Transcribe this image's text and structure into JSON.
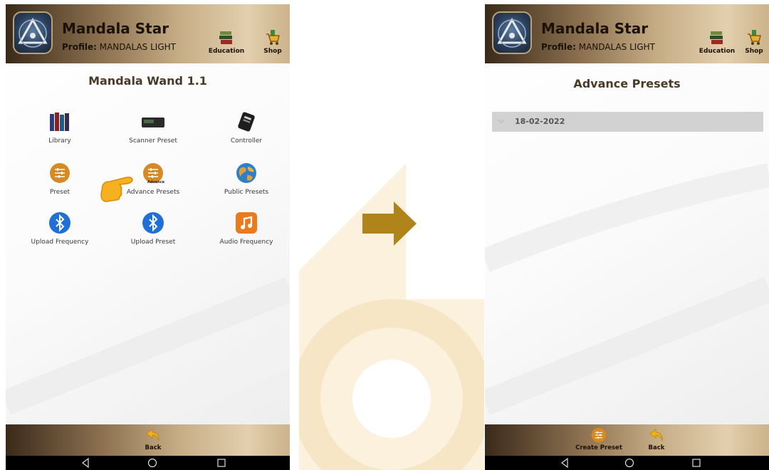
{
  "colors": {
    "header_gold": "#c4ab84",
    "header_dark": "#3a2a1a",
    "arrow": "#b0841a",
    "icon_orange": "#d78a23",
    "row_grey": "#d2d2d2"
  },
  "left_screen": {
    "header": {
      "app_title": "Mandala Star",
      "profile_label": "Profile:",
      "profile_name": "MANDALAS LIGHT",
      "education_label": "Education",
      "shop_label": "Shop"
    },
    "page_title": "Mandala Wand 1.1",
    "grid": [
      {
        "label": "Library",
        "icon": "books-icon"
      },
      {
        "label": "Scanner Preset",
        "icon": "scanner-device-icon"
      },
      {
        "label": "Controller",
        "icon": "controller-device-icon"
      },
      {
        "label": "Preset",
        "icon": "sliders-icon"
      },
      {
        "label": "Advance Presets",
        "icon": "sliders-icon",
        "icon_caption": "Advance"
      },
      {
        "label": "Public Presets",
        "icon": "globe-icon"
      },
      {
        "label": "Upload Frequency",
        "icon": "bluetooth-icon"
      },
      {
        "label": "Upload Preset",
        "icon": "bluetooth-icon"
      },
      {
        "label": "Audio Frequency",
        "icon": "music-note-icon"
      }
    ],
    "footer": {
      "back_label": "Back"
    }
  },
  "right_screen": {
    "header": {
      "app_title": "Mandala Star",
      "profile_label": "Profile:",
      "profile_name": "MANDALAS LIGHT",
      "education_label": "Education",
      "shop_label": "Shop"
    },
    "page_title": "Advance Presets",
    "presets": [
      {
        "date": "18-02-2022"
      }
    ],
    "footer": {
      "create_label": "Create Preset",
      "back_label": "Back"
    }
  }
}
